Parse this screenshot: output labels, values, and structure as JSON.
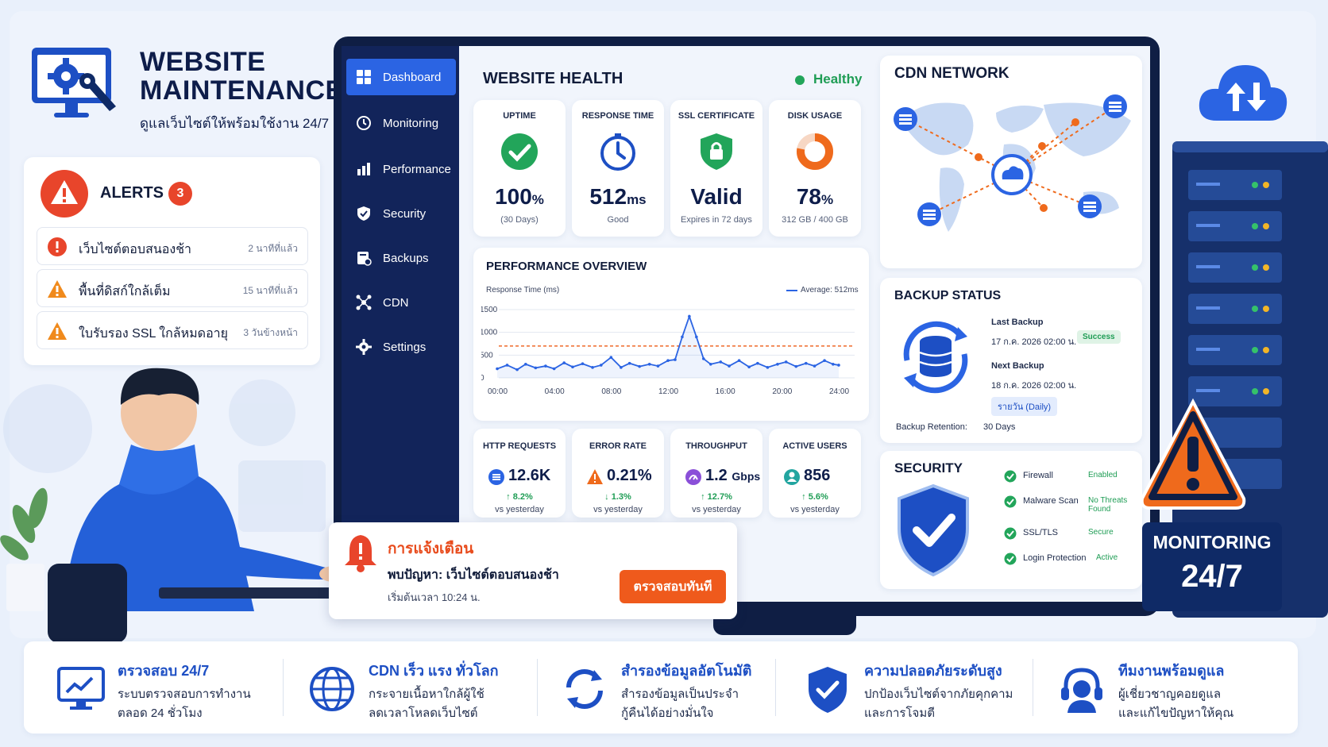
{
  "brand": {
    "title_line1": "WEBSITE",
    "title_line2": "MAINTENANCE",
    "subtitle": "ดูแลเว็บไซต์ให้พร้อมใช้งาน 24/7"
  },
  "alerts": {
    "title": "ALERTS",
    "count": "3",
    "items": [
      {
        "text": "เว็บไซต์ตอบสนองช้า",
        "time": "2 นาทีที่แล้ว",
        "severity": "error"
      },
      {
        "text": "พื้นที่ดิสก์ใกล้เต็ม",
        "time": "15 นาทีที่แล้ว",
        "severity": "warning"
      },
      {
        "text": "ใบรับรอง SSL ใกล้หมดอายุ",
        "time": "3 วันข้างหน้า",
        "severity": "warning"
      }
    ]
  },
  "nav": {
    "items": [
      {
        "label": "Dashboard",
        "icon": "grid-icon",
        "active": true
      },
      {
        "label": "Monitoring",
        "icon": "clock-icon"
      },
      {
        "label": "Performance",
        "icon": "bar-chart-icon"
      },
      {
        "label": "Security",
        "icon": "shield-icon"
      },
      {
        "label": "Backups",
        "icon": "backup-icon"
      },
      {
        "label": "CDN",
        "icon": "network-icon"
      },
      {
        "label": "Settings",
        "icon": "gear-icon"
      }
    ]
  },
  "health": {
    "title": "WEBSITE HEALTH",
    "status": "Healthy",
    "metrics": [
      {
        "label": "UPTIME",
        "value": "100",
        "unit": "%",
        "sub": "(30 Days)",
        "icon": "check-circle-icon"
      },
      {
        "label": "RESPONSE TIME",
        "value": "512",
        "unit": "ms",
        "sub": "Good",
        "icon": "stopwatch-icon"
      },
      {
        "label": "SSL CERTIFICATE",
        "value": "Valid",
        "unit": "",
        "sub": "Expires in 72 days",
        "icon": "lock-shield-icon"
      },
      {
        "label": "DISK USAGE",
        "value": "78",
        "unit": "%",
        "sub": "312 GB / 400 GB",
        "icon": "donut-icon",
        "fraction": 0.78
      }
    ]
  },
  "performance": {
    "title": "PERFORMANCE OVERVIEW",
    "ylabel": "Response Time (ms)",
    "legend": "Average: 512ms"
  },
  "chart_data": {
    "type": "line",
    "title": "PERFORMANCE OVERVIEW",
    "ylabel": "Response Time (ms)",
    "x_ticks": [
      "00:00",
      "04:00",
      "08:00",
      "12:00",
      "16:00",
      "20:00",
      "24:00"
    ],
    "y_ticks": [
      0,
      500,
      1000,
      1500
    ],
    "ylim": [
      0,
      1500
    ],
    "xlim": [
      0,
      24
    ],
    "series": [
      {
        "name": "Response Time",
        "color": "#2b64e3",
        "x": [
          0,
          0.7,
          1.4,
          2.0,
          2.7,
          3.4,
          4.0,
          4.7,
          5.3,
          6.0,
          6.7,
          7.3,
          8.0,
          8.7,
          9.3,
          10.0,
          10.7,
          11.3,
          12.0,
          12.5,
          13.0,
          13.5,
          14.0,
          14.5,
          15.0,
          15.7,
          16.3,
          17.0,
          17.7,
          18.3,
          19.0,
          19.7,
          20.3,
          21.0,
          21.7,
          22.3,
          23.0,
          23.6,
          24.0
        ],
        "y": [
          200,
          280,
          180,
          300,
          220,
          260,
          200,
          330,
          240,
          310,
          230,
          280,
          450,
          230,
          320,
          250,
          300,
          260,
          380,
          400,
          900,
          1350,
          900,
          420,
          300,
          350,
          260,
          380,
          240,
          320,
          230,
          300,
          350,
          250,
          320,
          260,
          380,
          300,
          280
        ]
      }
    ],
    "average": {
      "label": "Average: 512ms",
      "value": 700,
      "color": "#ef6a2a"
    },
    "grid": true,
    "legend": "top-right"
  },
  "stats": [
    {
      "label": "HTTP REQUESTS",
      "value": "12.6K",
      "unit": "",
      "change": "↑ 8.2%",
      "compare": "vs yesterday",
      "icon": "list-icon",
      "color": "#2b64e3"
    },
    {
      "label": "ERROR RATE",
      "value": "0.21%",
      "unit": "",
      "change": "↓ 1.3%",
      "compare": "vs yesterday",
      "icon": "warning-icon",
      "color": "#ef6a1c"
    },
    {
      "label": "THROUGHPUT",
      "value": "1.2",
      "unit": "Gbps",
      "change": "↑ 12.7%",
      "compare": "vs yesterday",
      "icon": "speed-icon",
      "color": "#8a4fd8"
    },
    {
      "label": "ACTIVE USERS",
      "value": "856",
      "unit": "",
      "change": "↑ 5.6%",
      "compare": "vs yesterday",
      "icon": "user-icon",
      "color": "#22a5a0"
    }
  ],
  "cdn": {
    "title": "CDN NETWORK"
  },
  "backup": {
    "title": "BACKUP STATUS",
    "last_label": "Last Backup",
    "last_value": "17 ก.ค. 2026 02:00 น.",
    "last_status": "Success",
    "next_label": "Next Backup",
    "next_value": "18 ก.ค. 2026 02:00 น.",
    "schedule": "รายวัน (Daily)",
    "retention_label": "Backup Retention:",
    "retention_value": "30 Days"
  },
  "security": {
    "title": "SECURITY",
    "items": [
      {
        "label": "Firewall",
        "status": "Enabled"
      },
      {
        "label": "Malware Scan",
        "status": "No Threats Found"
      },
      {
        "label": "SSL/TLS",
        "status": "Secure"
      },
      {
        "label": "Login Protection",
        "status": "Active"
      }
    ]
  },
  "notification": {
    "title": "การแจ้งเตือน",
    "message": "พบปัญหา: เว็บไซต์ตอบสนองช้า",
    "time": "เริ่มต้นเวลา 10:24 น.",
    "button": "ตรวจสอบทันที"
  },
  "monitoring_badge": {
    "line1": "MONITORING",
    "line2": "24/7"
  },
  "features": [
    {
      "title": "ตรวจสอบ 24/7",
      "line1": "ระบบตรวจสอบการทำงาน",
      "line2": "ตลอด 24 ชั่วโมง",
      "icon": "monitor-chart-icon"
    },
    {
      "title": "CDN เร็ว แรง ทั่วโลก",
      "line1": "กระจายเนื้อหาใกล้ผู้ใช้",
      "line2": "ลดเวลาโหลดเว็บไซต์",
      "icon": "globe-icon"
    },
    {
      "title": "สำรองข้อมูลอัตโนมัติ",
      "line1": "สำรองข้อมูลเป็นประจำ",
      "line2": "กู้คืนได้อย่างมั่นใจ",
      "icon": "sync-icon"
    },
    {
      "title": "ความปลอดภัยระดับสูง",
      "line1": "ปกป้องเว็บไซต์จากภัยคุกคาม",
      "line2": "และการโจมตี",
      "icon": "shield-check-icon"
    },
    {
      "title": "ทีมงานพร้อมดูแล",
      "line1": "ผู้เชี่ยวชาญคอยดูแล",
      "line2": "และแก้ไขปัญหาให้คุณ",
      "icon": "headset-icon"
    }
  ]
}
